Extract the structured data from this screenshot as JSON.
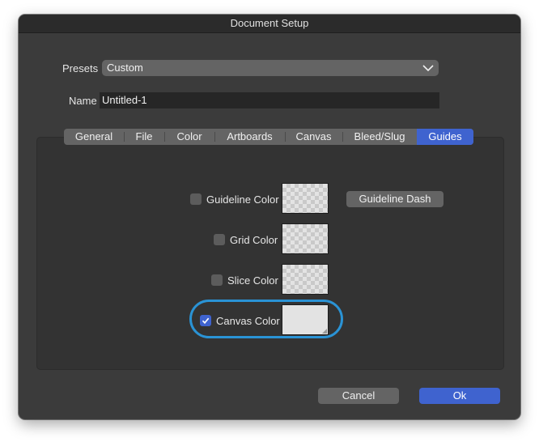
{
  "window": {
    "title": "Document Setup"
  },
  "presets": {
    "label": "Presets",
    "value": "Custom"
  },
  "name": {
    "label": "Name",
    "value": "Untitled-1"
  },
  "tabs": [
    {
      "label": "General",
      "active": false
    },
    {
      "label": "File",
      "active": false
    },
    {
      "label": "Color",
      "active": false
    },
    {
      "label": "Artboards",
      "active": false
    },
    {
      "label": "Canvas",
      "active": false
    },
    {
      "label": "Bleed/Slug",
      "active": false
    },
    {
      "label": "Guides",
      "active": true
    }
  ],
  "guides": {
    "guideline_color": {
      "label": "Guideline Color",
      "checked": false
    },
    "guideline_dash": {
      "label": "Guideline Dash"
    },
    "grid_color": {
      "label": "Grid Color",
      "checked": false
    },
    "slice_color": {
      "label": "Slice Color",
      "checked": false
    },
    "canvas_color": {
      "label": "Canvas Color",
      "checked": true
    }
  },
  "footer": {
    "cancel_label": "Cancel",
    "ok_label": "Ok"
  },
  "colors": {
    "accent": "#3f63cf",
    "highlight_ring": "#2a93d5",
    "dialog_bg": "#3b3b3b",
    "canvas_swatch": "#e3e3e3"
  }
}
